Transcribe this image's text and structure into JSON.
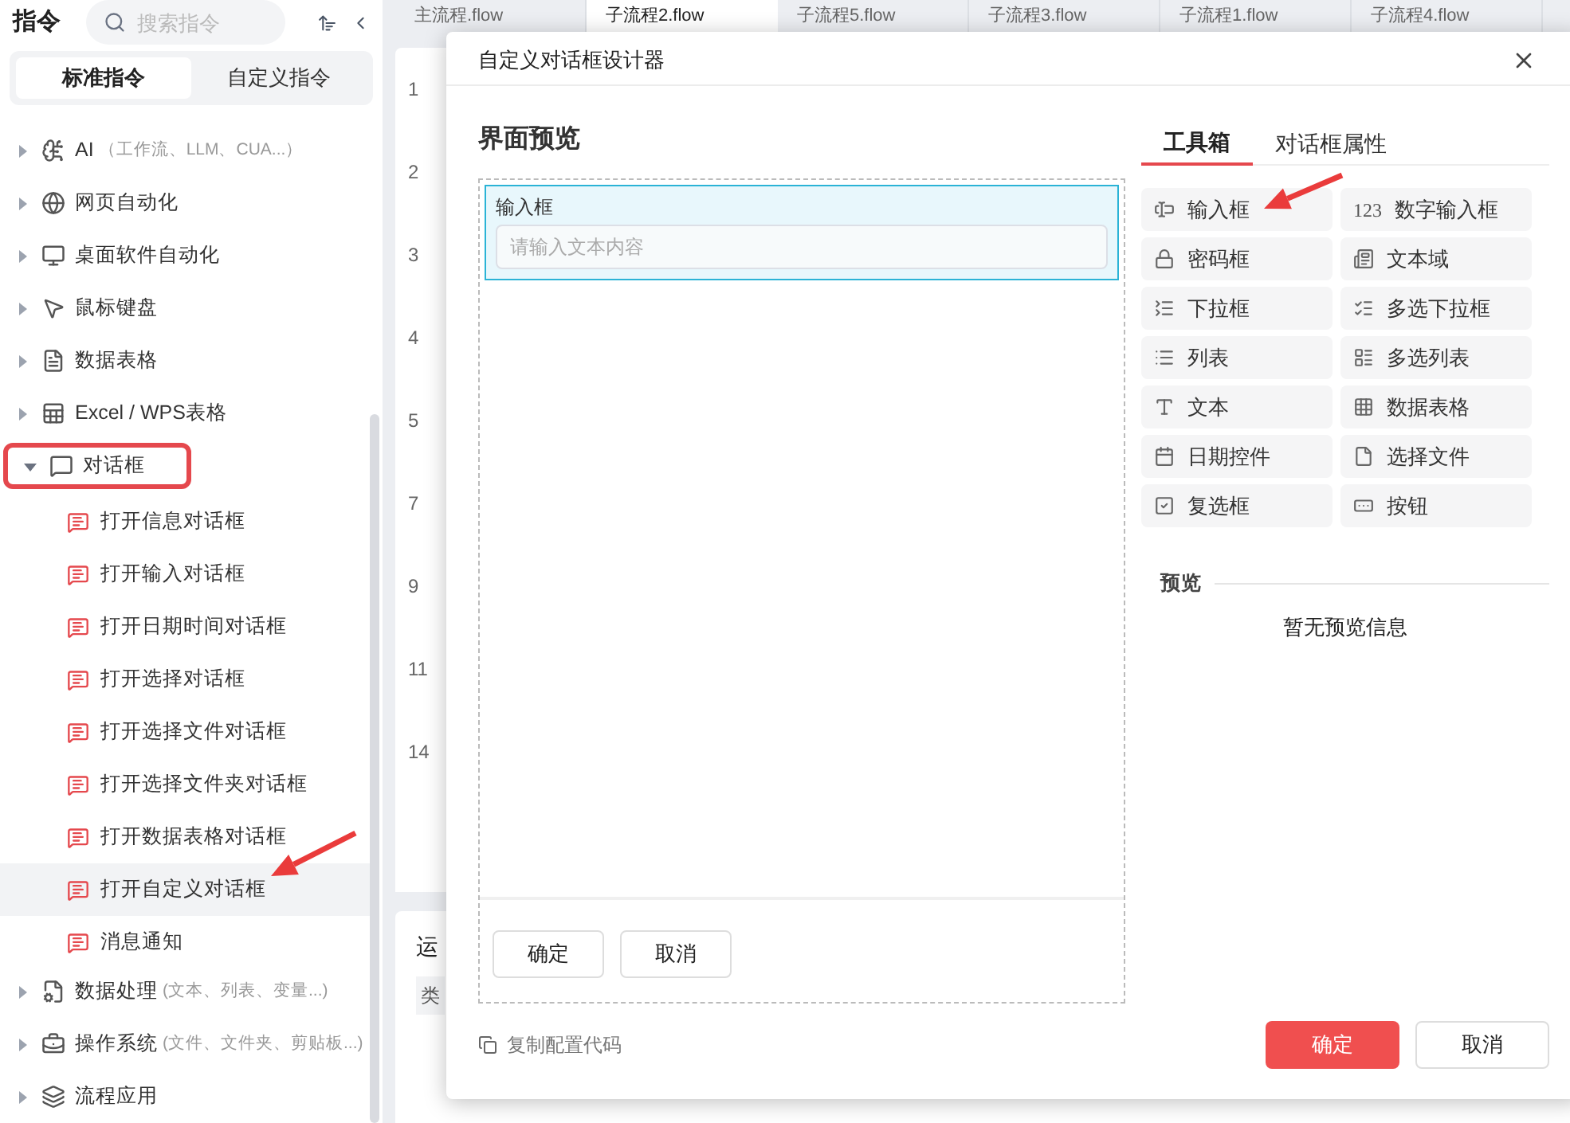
{
  "sidebar": {
    "title": "指令",
    "search": {
      "placeholder": "搜索指令"
    },
    "tabs": [
      {
        "label": "标准指令",
        "selected": true
      },
      {
        "label": "自定义指令",
        "selected": false
      }
    ],
    "items": [
      {
        "label": "AI",
        "note": "（工作流、LLM、CUA...）",
        "expanded": false,
        "highlighted": false
      },
      {
        "label": "网页自动化",
        "expanded": false,
        "highlighted": false
      },
      {
        "label": "桌面软件自动化",
        "expanded": false,
        "highlighted": false
      },
      {
        "label": "鼠标键盘",
        "expanded": false,
        "highlighted": false
      },
      {
        "label": "数据表格",
        "expanded": false,
        "highlighted": false
      },
      {
        "label": "Excel / WPS表格",
        "expanded": false,
        "highlighted": false
      },
      {
        "label": "对话框",
        "expanded": true,
        "highlighted": true,
        "children": [
          {
            "label": "打开信息对话框",
            "selected": false
          },
          {
            "label": "打开输入对话框",
            "selected": false
          },
          {
            "label": "打开日期时间对话框",
            "selected": false
          },
          {
            "label": "打开选择对话框",
            "selected": false
          },
          {
            "label": "打开选择文件对话框",
            "selected": false
          },
          {
            "label": "打开选择文件夹对话框",
            "selected": false
          },
          {
            "label": "打开数据表格对话框",
            "selected": false
          },
          {
            "label": "打开自定义对话框",
            "selected": true
          },
          {
            "label": "消息通知",
            "selected": false
          }
        ]
      },
      {
        "label": "数据处理",
        "note": "(文本、列表、变量...)",
        "expanded": false,
        "highlighted": false
      },
      {
        "label": "操作系统",
        "note": "(文件、文件夹、剪贴板...)",
        "expanded": false,
        "highlighted": false
      },
      {
        "label": "流程应用",
        "expanded": false,
        "highlighted": false
      }
    ]
  },
  "editor": {
    "tabs": [
      {
        "label": "主流程.flow",
        "selected": false
      },
      {
        "label": "子流程2.flow",
        "selected": true
      },
      {
        "label": "子流程5.flow",
        "selected": false
      },
      {
        "label": "子流程3.flow",
        "selected": false
      },
      {
        "label": "子流程1.flow",
        "selected": false
      },
      {
        "label": "子流程4.flow",
        "selected": false
      }
    ],
    "line_numbers": [
      "1",
      "2",
      "3",
      "4",
      "5",
      "7",
      "9",
      "11",
      "14"
    ],
    "bottom_panel": {
      "title": "运",
      "column_1": "类"
    }
  },
  "dialog": {
    "title": "自定义对话框设计器",
    "preview": {
      "title": "界面预览",
      "component": {
        "label": "输入框",
        "placeholder": "请输入文本内容",
        "selected": true
      },
      "buttons": [
        "确定",
        "取消"
      ]
    },
    "tabs": [
      {
        "label": "工具箱",
        "selected": true
      },
      {
        "label": "对话框属性",
        "selected": false
      }
    ],
    "tools": [
      {
        "label": "输入框"
      },
      {
        "label": "数字输入框",
        "icon_text": "123"
      },
      {
        "label": "密码框"
      },
      {
        "label": "文本域"
      },
      {
        "label": "下拉框"
      },
      {
        "label": "多选下拉框"
      },
      {
        "label": "列表"
      },
      {
        "label": "多选列表"
      },
      {
        "label": "文本"
      },
      {
        "label": "数据表格"
      },
      {
        "label": "日期控件"
      },
      {
        "label": "选择文件"
      },
      {
        "label": "复选框"
      },
      {
        "label": "按钮"
      }
    ],
    "preview_section": {
      "title": "预览",
      "empty": "暂无预览信息"
    },
    "copy_config": "复制配置代码",
    "buttons": [
      {
        "label": "确定",
        "kind": "primary"
      },
      {
        "label": "取消",
        "kind": "secondary"
      }
    ]
  }
}
